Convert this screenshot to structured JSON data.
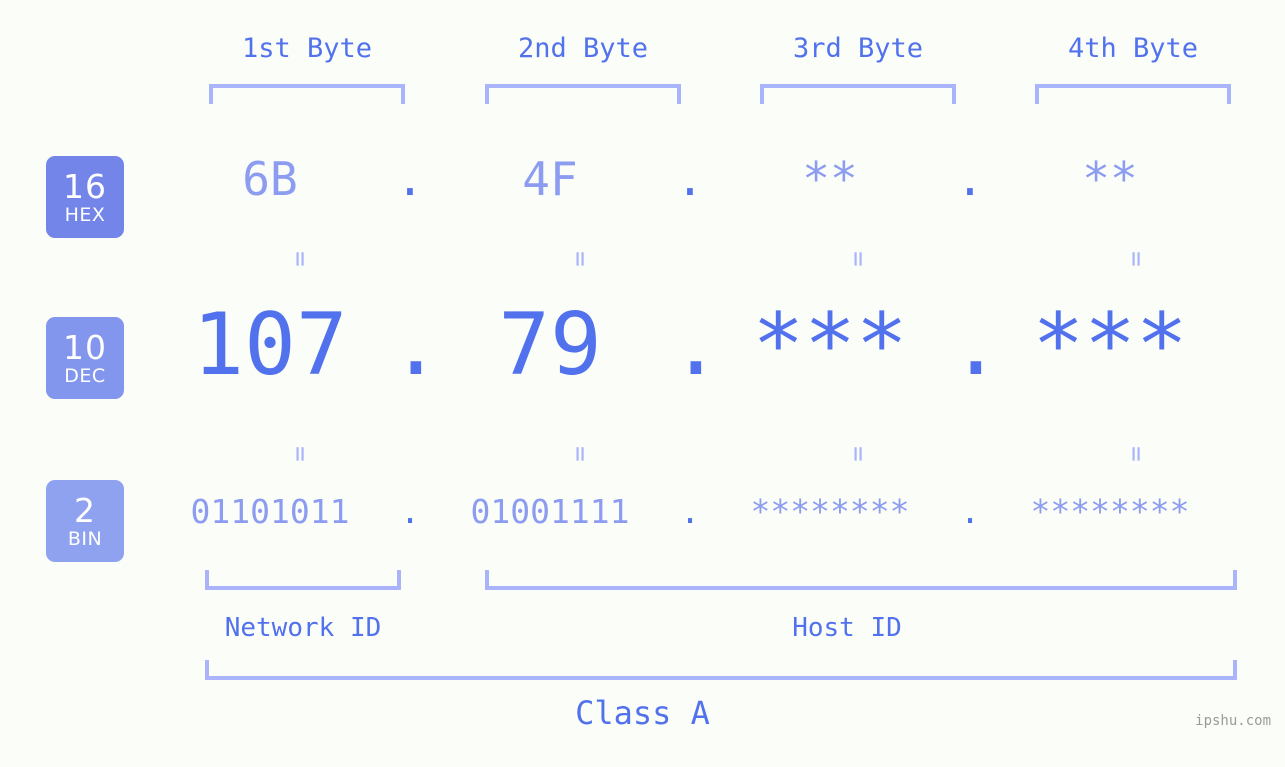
{
  "theme": {
    "background": "#fbfdf8",
    "accent_strong": "#5271ed",
    "accent_light": "#8c9cf0",
    "bracket": "#aab4fb",
    "badge_hex_bg": "#7385e8",
    "badge_dec_bg": "#8396ee",
    "badge_bin_bg": "#8fa2f0",
    "watermark_color": "#9b9b9b"
  },
  "columns": [
    {
      "label": "1st Byte"
    },
    {
      "label": "2nd Byte"
    },
    {
      "label": "3rd Byte"
    },
    {
      "label": "4th Byte"
    }
  ],
  "bases": [
    {
      "num": "16",
      "name": "HEX"
    },
    {
      "num": "10",
      "name": "DEC"
    },
    {
      "num": "2",
      "name": "BIN"
    }
  ],
  "rows": {
    "hex": {
      "base": "16",
      "values": [
        "6B",
        "4F",
        "**",
        "**"
      ],
      "separator": "."
    },
    "dec": {
      "base": "10",
      "values": [
        "107",
        "79",
        "***",
        "***"
      ],
      "separator": "."
    },
    "bin": {
      "base": "2",
      "values": [
        "01101011",
        "01001111",
        "********",
        "********"
      ],
      "separator": "."
    }
  },
  "connectors": {
    "glyph": "=",
    "count_per_row_gap": 4
  },
  "segments": {
    "network_id": "Network ID",
    "host_id": "Host ID"
  },
  "class": {
    "label": "Class A"
  },
  "watermark": {
    "text": "ipshu.com"
  }
}
